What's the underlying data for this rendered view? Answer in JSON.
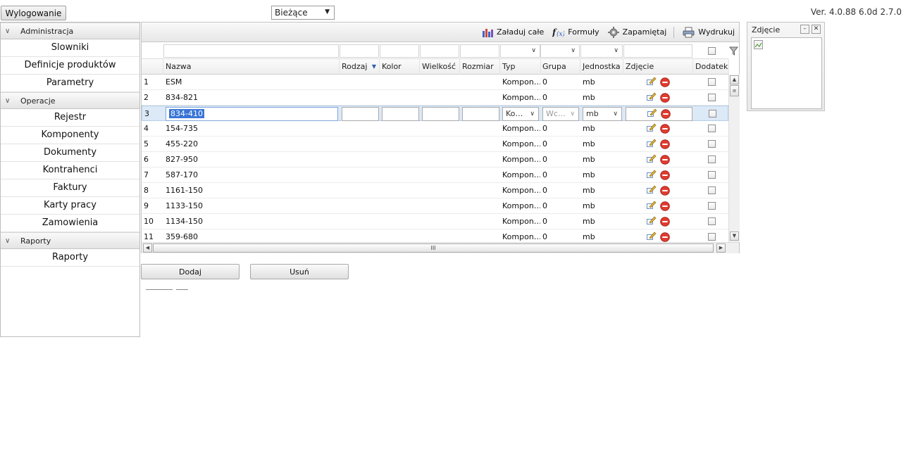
{
  "top": {
    "logout_label": "Wylogowanie",
    "period_value": "Bieżące",
    "version": "Ver. 4.0.88 6.0d 2.7.0"
  },
  "sidebar": {
    "sections": [
      {
        "title": "Administracja",
        "items": [
          "Slowniki",
          "Definicje produktów",
          "Parametry"
        ]
      },
      {
        "title": "Operacje",
        "items": [
          "Rejestr",
          "Komponenty",
          "Dokumenty",
          "Kontrahenci",
          "Faktury",
          "Karty pracy",
          "Zamowienia"
        ]
      },
      {
        "title": "Raporty",
        "items": [
          "Raporty"
        ]
      }
    ]
  },
  "toolbar": {
    "load_all": "Załaduj całe",
    "formulas": "Formuły",
    "remember": "Zapamiętaj",
    "print": "Wydrukuj"
  },
  "grid": {
    "columns": [
      "Nazwa",
      "Rodzaj",
      "Kolor",
      "Wielkość",
      "Rozmiar",
      "Typ",
      "Grupa",
      "Jednostka",
      "Zdjęcie",
      "Dodatek"
    ],
    "rows": [
      {
        "num": "1",
        "nazwa": "ESM",
        "typ": "Kompon…",
        "grupa": "0",
        "jednostka": "mb"
      },
      {
        "num": "2",
        "nazwa": "834-821",
        "typ": "Kompon…",
        "grupa": "0",
        "jednostka": "mb"
      },
      {
        "num": "3",
        "nazwa": "834-410",
        "typ": "Ko…",
        "grupa": "Wc…",
        "jednostka": "mb",
        "editing": true
      },
      {
        "num": "4",
        "nazwa": "154-735",
        "typ": "Kompon…",
        "grupa": "0",
        "jednostka": "mb"
      },
      {
        "num": "5",
        "nazwa": "455-220",
        "typ": "Kompon…",
        "grupa": "0",
        "jednostka": "mb"
      },
      {
        "num": "6",
        "nazwa": "827-950",
        "typ": "Kompon…",
        "grupa": "0",
        "jednostka": "mb"
      },
      {
        "num": "7",
        "nazwa": "587-170",
        "typ": "Kompon…",
        "grupa": "0",
        "jednostka": "mb"
      },
      {
        "num": "8",
        "nazwa": "1161-150",
        "typ": "Kompon…",
        "grupa": "0",
        "jednostka": "mb"
      },
      {
        "num": "9",
        "nazwa": "1133-150",
        "typ": "Kompon…",
        "grupa": "0",
        "jednostka": "mb"
      },
      {
        "num": "10",
        "nazwa": "1134-150",
        "typ": "Kompon…",
        "grupa": "0",
        "jednostka": "mb"
      },
      {
        "num": "11",
        "nazwa": "359-680",
        "typ": "Kompon…",
        "grupa": "0",
        "jednostka": "mb"
      }
    ],
    "sort_column": "Rodzaj",
    "hscroll_grip": "III"
  },
  "photo_panel": {
    "title": "Zdjęcie"
  },
  "actions": {
    "add_label": "Dodaj",
    "remove_label": "Usuń"
  },
  "colors": {
    "selected_row": "#dce9f7",
    "text_selection": "#3875d7",
    "delete_icon": "#e03c31"
  }
}
